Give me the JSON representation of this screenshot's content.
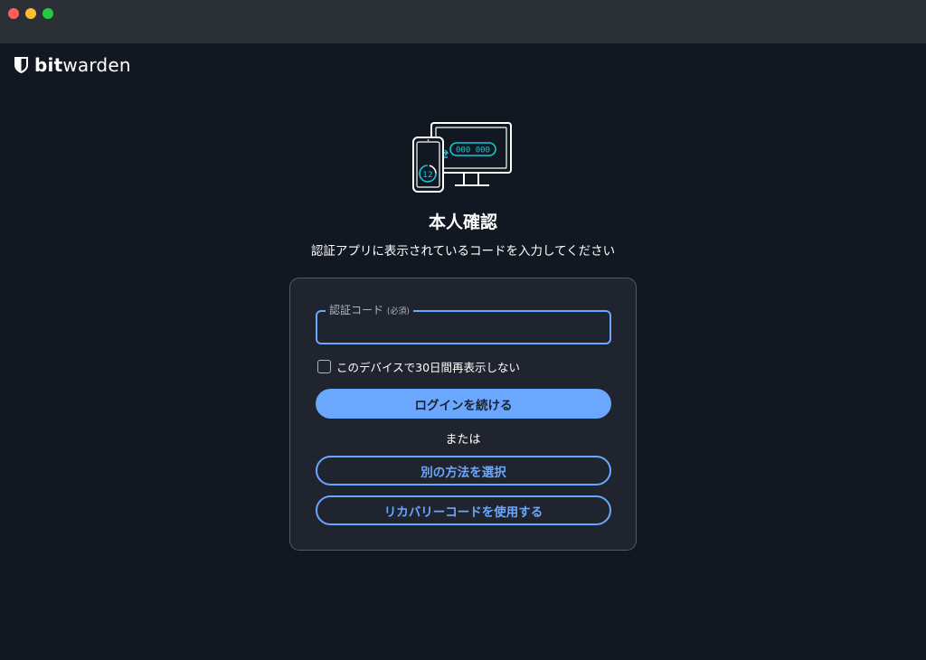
{
  "app": {
    "brand_bold": "bit",
    "brand_light": "warden"
  },
  "window": {
    "controls": [
      "close",
      "minimize",
      "maximize"
    ]
  },
  "illustration": {
    "code_text": "000 000",
    "timer_text": "12",
    "icon": "two-factor-devices-icon"
  },
  "page": {
    "title": "本人確認",
    "subtitle": "認証アプリに表示されているコードを入力してください"
  },
  "form": {
    "code_label": "認証コード",
    "code_required": "(必須)",
    "code_value": "",
    "remember_label": "このデバイスで30日間再表示しない",
    "remember_checked": false,
    "continue_label": "ログインを続ける",
    "or_text": "または",
    "alt_method_label": "別の方法を選択",
    "recovery_label": "リカバリーコードを使用する"
  },
  "colors": {
    "background": "#121821",
    "titlebar": "#2b2f36",
    "card": "#1f242e",
    "accent": "#6aa7ff",
    "teal": "#17c5d8"
  }
}
